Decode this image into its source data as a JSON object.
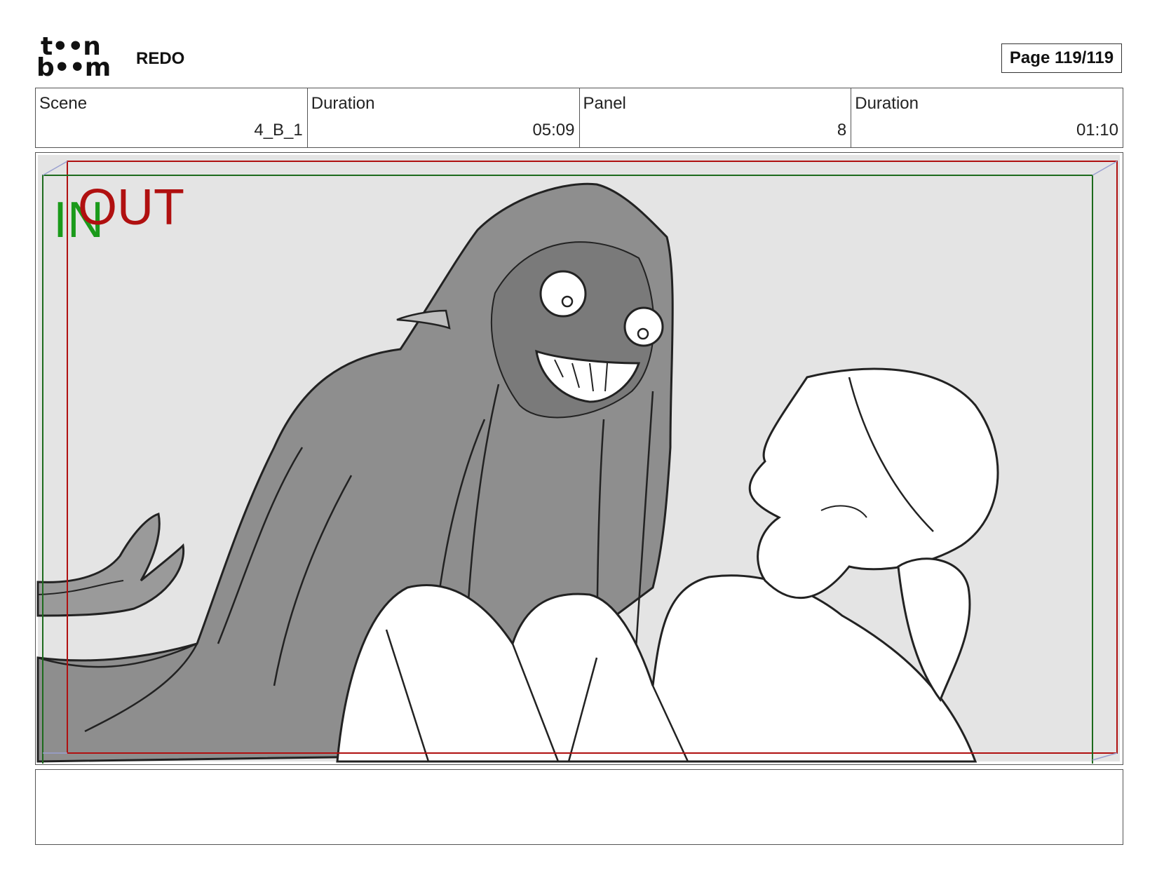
{
  "header": {
    "logo_line1": "t••n",
    "logo_line2": "b••m",
    "project_title": "REDO",
    "page_indicator": "Page 119/119"
  },
  "info": {
    "scene_label": "Scene",
    "scene_value": "4_B_1",
    "scene_duration_label": "Duration",
    "scene_duration_value": "05:09",
    "panel_label": "Panel",
    "panel_value": "8",
    "panel_duration_label": "Duration",
    "panel_duration_value": "01:10"
  },
  "panel": {
    "in_marker": "IN",
    "out_marker": "OUT",
    "in_color": "#1a9a1a",
    "out_color": "#b01010"
  },
  "notes": {
    "text": ""
  }
}
